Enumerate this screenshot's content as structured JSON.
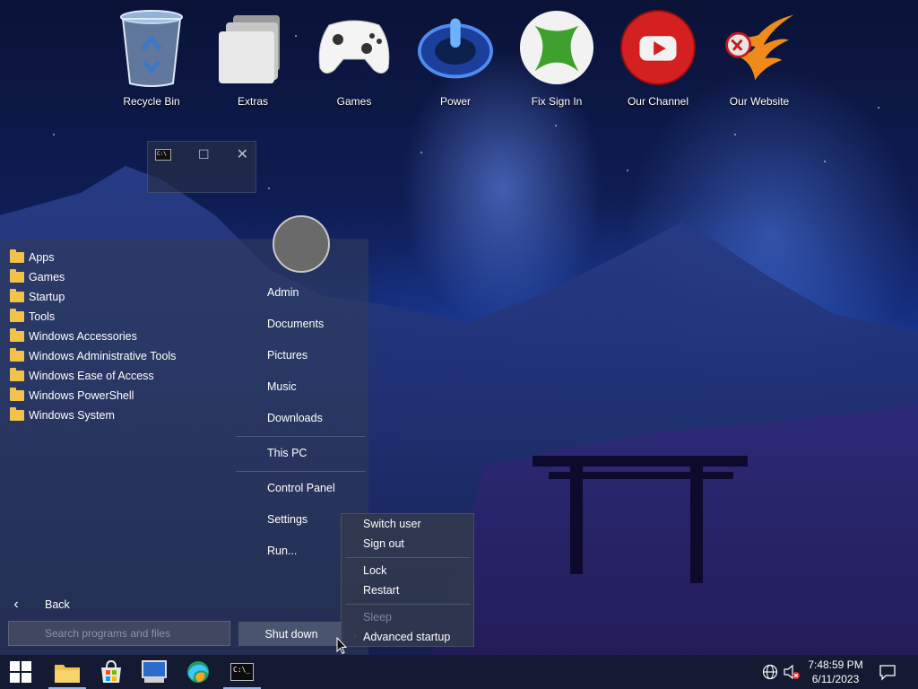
{
  "desktop": {
    "icons": [
      {
        "label": "Recycle Bin",
        "icon": "recycle-bin-icon"
      },
      {
        "label": "Extras",
        "icon": "folder-stack-icon"
      },
      {
        "label": "Games",
        "icon": "gamepad-icon"
      },
      {
        "label": "Power",
        "icon": "power-icon"
      },
      {
        "label": "Fix Sign In",
        "icon": "xbox-icon"
      },
      {
        "label": "Our Channel",
        "icon": "youtube-icon"
      },
      {
        "label": "Our Website",
        "icon": "phoenix-logo-icon"
      }
    ]
  },
  "cmd_window": {
    "icon": "command-prompt-icon",
    "cmd_glyph": "C:\\"
  },
  "start_menu": {
    "folders": [
      "Apps",
      "Games",
      "Startup",
      "Tools",
      "Windows Accessories",
      "Windows Administrative Tools",
      "Windows Ease of Access",
      "Windows PowerShell",
      "Windows System"
    ],
    "back_label": "Back",
    "search_placeholder": "Search programs and files",
    "right_items": {
      "admin": "Admin",
      "documents": "Documents",
      "pictures": "Pictures",
      "music": "Music",
      "downloads": "Downloads",
      "this_pc": "This PC",
      "control_panel": "Control Panel",
      "settings": "Settings",
      "run": "Run..."
    },
    "shutdown_label": "Shut down"
  },
  "power_menu": {
    "switch_user": "Switch user",
    "sign_out": "Sign out",
    "lock": "Lock",
    "restart": "Restart",
    "sleep": "Sleep",
    "advanced_startup": "Advanced startup"
  },
  "taskbar": {
    "apps": [
      "start-icon",
      "file-explorer-icon",
      "microsoft-store-icon",
      "remote-desktop-icon",
      "edge-browser-icon",
      "command-prompt-icon"
    ],
    "cmd_glyph": "C:\\_",
    "time": "7:48:59 PM",
    "date": "6/11/2023"
  },
  "colors": {
    "folder": "#f2c24a",
    "taskbar": "#141a30",
    "accent": "#8fb4e6"
  }
}
